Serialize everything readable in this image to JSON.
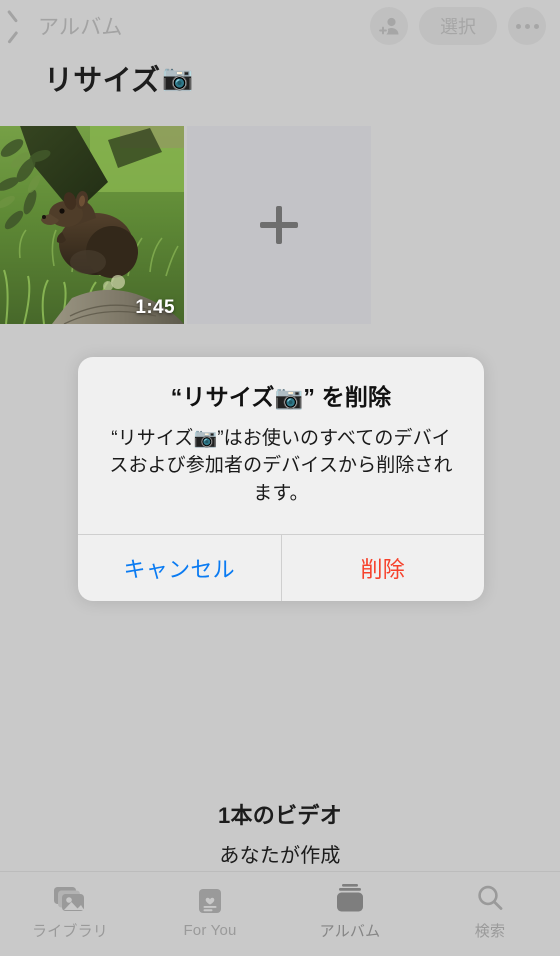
{
  "colors": {
    "dim_background": "#c9c9c9",
    "alert_background": "#f0f0f0",
    "cancel_blue": "#0a7bf2",
    "destructive_red": "#f6412b",
    "title_text": "#1d1d1d",
    "dim_text": "#a3a3a3",
    "tile_placeholder": "#c3c3c7"
  },
  "navbar": {
    "back_label": "アルバム",
    "back_icon": "chevron-left-icon",
    "add_people_icon": "person-add-icon",
    "select_label": "選択",
    "more_icon": "ellipsis-icon"
  },
  "album": {
    "title": "リサイズ",
    "title_emoji": "📷",
    "items": [
      {
        "type": "video",
        "duration": "1:45",
        "alt": "grass field with small brown marsupial"
      },
      {
        "type": "add-placeholder",
        "icon": "plus-icon"
      }
    ],
    "footer_count": "1本のビデオ",
    "footer_subtitle": "あなたが作成"
  },
  "alert": {
    "title": "“リサイズ📷” を削除",
    "message": "“リサイズ📷”はお使いのすべてのデバイスおよび参加者のデバイスから削除されます。",
    "cancel_label": "キャンセル",
    "delete_label": "削除"
  },
  "tabbar": {
    "tabs": [
      {
        "label": "ライブラリ",
        "icon": "photo-stack-icon",
        "selected": false
      },
      {
        "label": "For You",
        "icon": "for-you-card-icon",
        "selected": false
      },
      {
        "label": "アルバム",
        "icon": "albums-stack-icon",
        "selected": true
      },
      {
        "label": "検索",
        "icon": "search-icon",
        "selected": false
      }
    ]
  }
}
